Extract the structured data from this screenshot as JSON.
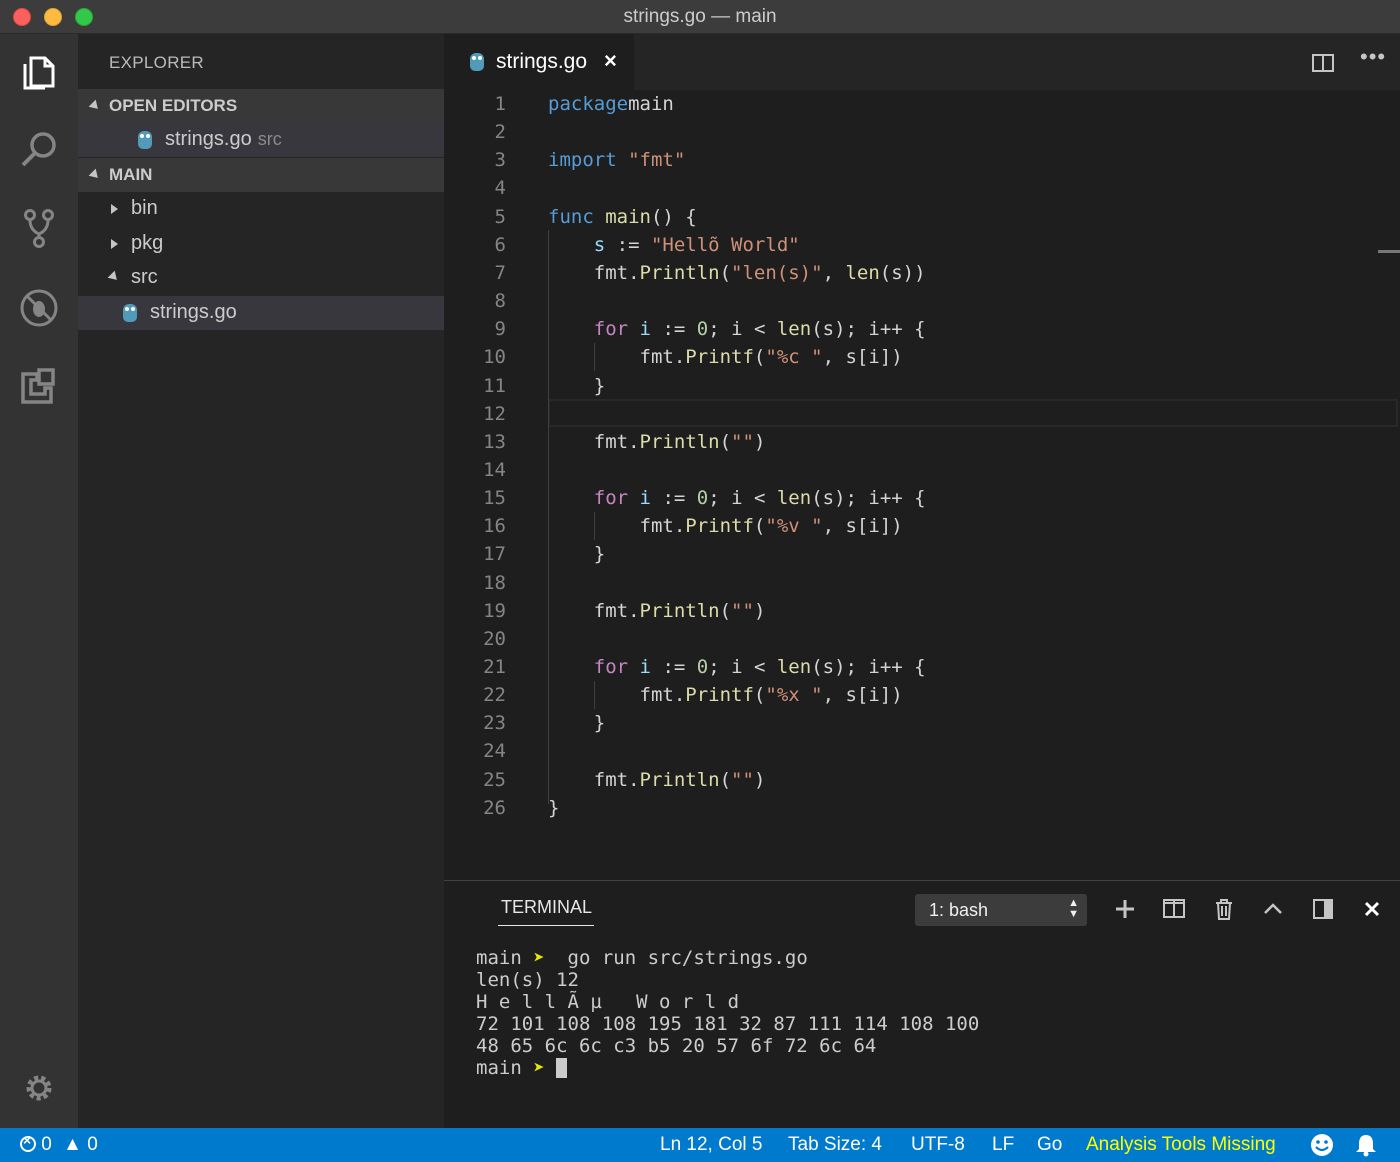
{
  "window": {
    "title": "strings.go — main"
  },
  "sidebar": {
    "title": "EXPLORER",
    "open_editors_header": "OPEN EDITORS",
    "open_editor_file": "strings.go",
    "open_editor_dir": "src",
    "folder_header": "MAIN",
    "tree": [
      {
        "label": "bin"
      },
      {
        "label": "pkg"
      },
      {
        "label": "src"
      },
      {
        "label": "strings.go"
      }
    ]
  },
  "editor": {
    "tab_label": "strings.go",
    "tab_close": "×",
    "more_actions": "•••",
    "line_numbers": [
      "1",
      "2",
      "3",
      "4",
      "5",
      "6",
      "7",
      "8",
      "9",
      "10",
      "11",
      "12",
      "13",
      "14",
      "15",
      "16",
      "17",
      "18",
      "19",
      "20",
      "21",
      "22",
      "23",
      "24",
      "25",
      "26"
    ],
    "lines": [
      [
        [
          "kw",
          "package"
        ],
        [
          "",
          "main"
        ]
      ],
      [],
      [
        [
          "kw",
          "import"
        ],
        [
          "",
          " "
        ],
        [
          "str",
          "\"fmt\""
        ]
      ],
      [],
      [
        [
          "kw",
          "func"
        ],
        [
          "",
          " "
        ],
        [
          "fn",
          "main"
        ],
        [
          "",
          "() {"
        ]
      ],
      [
        [
          "",
          "    "
        ],
        [
          "var",
          "s"
        ],
        [
          "",
          " := "
        ],
        [
          "str",
          "\"Hellõ World\""
        ]
      ],
      [
        [
          "",
          "    fmt."
        ],
        [
          "fn",
          "Println"
        ],
        [
          "",
          "("
        ],
        [
          "str",
          "\"len(s)\""
        ],
        [
          "",
          ", "
        ],
        [
          "fn",
          "len"
        ],
        [
          "",
          "(s))"
        ]
      ],
      [],
      [
        [
          "",
          "    "
        ],
        [
          "ctl",
          "for"
        ],
        [
          "",
          " "
        ],
        [
          "var",
          "i"
        ],
        [
          "",
          " := "
        ],
        [
          "num",
          "0"
        ],
        [
          "",
          "; i < "
        ],
        [
          "fn",
          "len"
        ],
        [
          "",
          "(s); i++ {"
        ]
      ],
      [
        [
          "",
          "        fmt."
        ],
        [
          "fn",
          "Printf"
        ],
        [
          "",
          "("
        ],
        [
          "str",
          "\"%c \""
        ],
        [
          "",
          ", s[i])"
        ]
      ],
      [
        [
          "",
          "    }"
        ]
      ],
      [],
      [
        [
          "",
          "    fmt."
        ],
        [
          "fn",
          "Println"
        ],
        [
          "",
          "("
        ],
        [
          "str",
          "\"\""
        ],
        [
          "",
          ")"
        ]
      ],
      [],
      [
        [
          "",
          "    "
        ],
        [
          "ctl",
          "for"
        ],
        [
          "",
          " "
        ],
        [
          "var",
          "i"
        ],
        [
          "",
          " := "
        ],
        [
          "num",
          "0"
        ],
        [
          "",
          "; i < "
        ],
        [
          "fn",
          "len"
        ],
        [
          "",
          "(s); i++ {"
        ]
      ],
      [
        [
          "",
          "        fmt."
        ],
        [
          "fn",
          "Printf"
        ],
        [
          "",
          "("
        ],
        [
          "str",
          "\"%v \""
        ],
        [
          "",
          ", s[i])"
        ]
      ],
      [
        [
          "",
          "    }"
        ]
      ],
      [],
      [
        [
          "",
          "    fmt."
        ],
        [
          "fn",
          "Println"
        ],
        [
          "",
          "("
        ],
        [
          "str",
          "\"\""
        ],
        [
          "",
          ")"
        ]
      ],
      [],
      [
        [
          "",
          "    "
        ],
        [
          "ctl",
          "for"
        ],
        [
          "",
          " "
        ],
        [
          "var",
          "i"
        ],
        [
          "",
          " := "
        ],
        [
          "num",
          "0"
        ],
        [
          "",
          "; i < "
        ],
        [
          "fn",
          "len"
        ],
        [
          "",
          "(s); i++ {"
        ]
      ],
      [
        [
          "",
          "        fmt."
        ],
        [
          "fn",
          "Printf"
        ],
        [
          "",
          "("
        ],
        [
          "str",
          "\"%x \""
        ],
        [
          "",
          ", s[i])"
        ]
      ],
      [
        [
          "",
          "    }"
        ]
      ],
      [],
      [
        [
          "",
          "    fmt."
        ],
        [
          "fn",
          "Println"
        ],
        [
          "",
          "("
        ],
        [
          "str",
          "\"\""
        ],
        [
          "",
          ")"
        ]
      ],
      [
        [
          "",
          "}"
        ]
      ]
    ]
  },
  "panel": {
    "title": "TERMINAL",
    "terminal_select": "1: bash",
    "terminal_lines": [
      {
        "prompt": "main",
        "arrow": "➤",
        "text": "  go run src/strings.go"
      },
      {
        "text": "len(s) 12"
      },
      {
        "text": "H e l l Ã µ   W o r l d"
      },
      {
        "text": "72 101 108 108 195 181 32 87 111 114 108 100"
      },
      {
        "text": "48 65 6c 6c c3 b5 20 57 6f 72 6c 64"
      },
      {
        "prompt": "main",
        "arrow": "➤",
        "text": " ",
        "cursor": true
      }
    ]
  },
  "statusbar": {
    "errors": "0",
    "warnings": "0",
    "position": "Ln 12, Col 5",
    "tab_size": "Tab Size: 4",
    "encoding": "UTF-8",
    "eol": "LF",
    "language": "Go",
    "analysis_warning": "Analysis Tools Missing"
  },
  "colors": {
    "statusbar": "#007acc",
    "keyword": "#569cd6",
    "control": "#c586c0",
    "string": "#ce9178",
    "function": "#dcdcaa",
    "variable": "#9cdcfe",
    "number": "#b5cea8",
    "warning": "#ffff00"
  },
  "icons": {
    "activity": [
      "files-icon",
      "search-icon",
      "source-control-icon",
      "debug-icon",
      "extensions-icon",
      "gear-icon"
    ],
    "panel_actions": [
      "plus-icon",
      "split-terminal-icon",
      "trash-icon",
      "chevron-up-icon",
      "maximize-panel-icon",
      "close-icon"
    ],
    "status_right": [
      "smiley-icon",
      "bell-icon"
    ]
  }
}
